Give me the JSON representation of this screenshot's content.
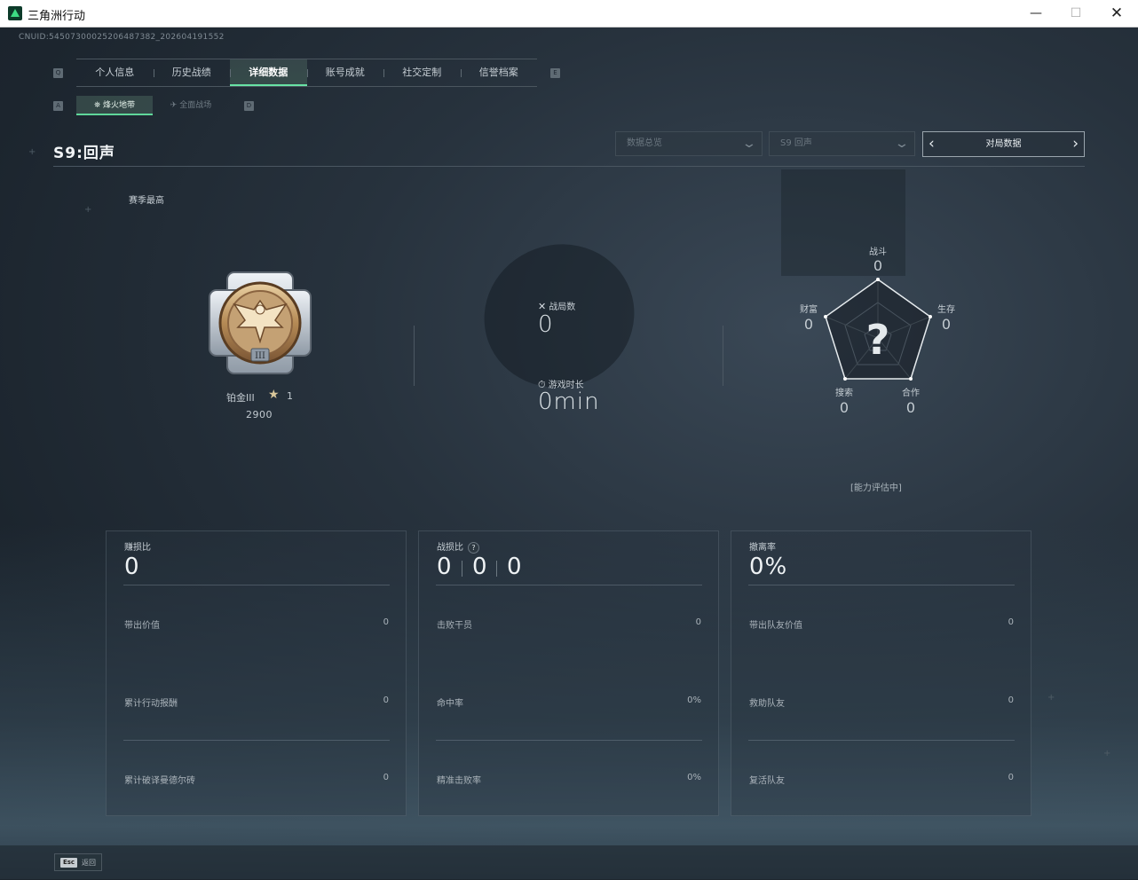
{
  "window": {
    "title": "三角洲行动",
    "minimize": "—",
    "maximize": "☐",
    "close": "✕"
  },
  "uid": "CNUID:5450730002520648738​2_202604191552",
  "tabs": {
    "left_key": "Q",
    "right_key": "E",
    "items": [
      {
        "label": "个人信息"
      },
      {
        "label": "历史战绩"
      },
      {
        "label": "详细数据",
        "active": true
      },
      {
        "label": "账号成就"
      },
      {
        "label": "社交定制"
      },
      {
        "label": "信誉档案"
      }
    ]
  },
  "subtabs": {
    "left_key": "A",
    "right_key": "D",
    "items": [
      {
        "label": "烽火地带",
        "icon": "fire-zone-icon",
        "active": true
      },
      {
        "label": "全面战场",
        "icon": "battlefield-icon"
      }
    ]
  },
  "season": {
    "title": "S9:回声",
    "best_label": "赛季最高"
  },
  "filters": {
    "overview": "数据总览",
    "season": "S9 回声",
    "match": "对局数据"
  },
  "rank": {
    "name": "铂金III",
    "stars": "1",
    "score": "2900"
  },
  "summary": {
    "matches_label": "战局数",
    "matches_value": "0",
    "playtime_label": "游戏时长",
    "playtime_value": "0min"
  },
  "radar": {
    "center": "?",
    "axes": [
      {
        "label": "战斗",
        "value": "0"
      },
      {
        "label": "生存",
        "value": "0"
      },
      {
        "label": "合作",
        "value": "0"
      },
      {
        "label": "搜索",
        "value": "0"
      },
      {
        "label": "财富",
        "value": "0"
      }
    ],
    "status": "[能力评估中]"
  },
  "panels": [
    {
      "title": "赚损比",
      "big": "0",
      "rows": [
        {
          "label": "带出价值",
          "value": "0"
        },
        {
          "label": "累计行动报酬",
          "value": "0"
        },
        {
          "label": "累计破译曼德尔砖",
          "value": "0"
        }
      ]
    },
    {
      "title": "战损比",
      "help": "?",
      "big_parts": [
        "0",
        "0",
        "0"
      ],
      "rows": [
        {
          "label": "击败干员",
          "value": "0"
        },
        {
          "label": "命中率",
          "value": "0%"
        },
        {
          "label": "精准击败率",
          "value": "0%"
        }
      ]
    },
    {
      "title": "撤离率",
      "big": "0%",
      "rows": [
        {
          "label": "带出队友价值",
          "value": "0"
        },
        {
          "label": "救助队友",
          "value": "0"
        },
        {
          "label": "复活队友",
          "value": "0"
        }
      ]
    }
  ],
  "footer": {
    "esc_key": "Esc",
    "esc_label": "返回"
  },
  "colors": {
    "accent": "#68e3a5",
    "background": "#1d2630",
    "text": "#c6ced4"
  }
}
